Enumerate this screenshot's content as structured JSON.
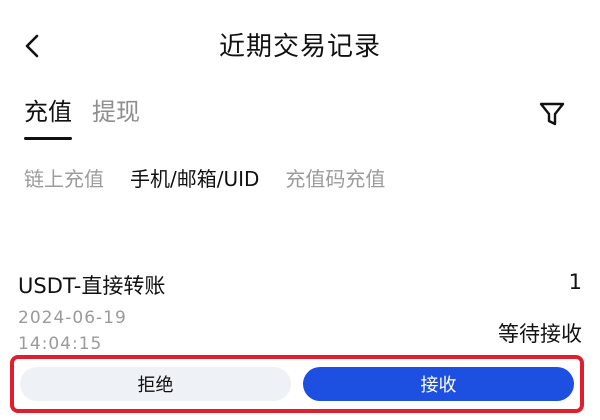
{
  "header": {
    "title": "近期交易记录",
    "back_icon": "chevron-left-icon"
  },
  "main_tabs": [
    {
      "label": "充值",
      "active": true
    },
    {
      "label": "提现",
      "active": false
    }
  ],
  "filter_icon": "filter-icon",
  "sub_tabs": [
    {
      "label": "链上充值",
      "active": false
    },
    {
      "label": "手机/邮箱/UID",
      "active": true
    },
    {
      "label": "充值码充值",
      "active": false
    }
  ],
  "record": {
    "title": "USDT-直接转账",
    "amount": "1",
    "date": "2024-06-19",
    "time": "14:04:15",
    "status": "等待接收"
  },
  "actions": {
    "reject_label": "拒绝",
    "accept_label": "接收"
  },
  "colors": {
    "accent_blue": "#1d4fe0",
    "highlight_red": "#e01e2e",
    "muted_text": "#9a9a9a"
  }
}
